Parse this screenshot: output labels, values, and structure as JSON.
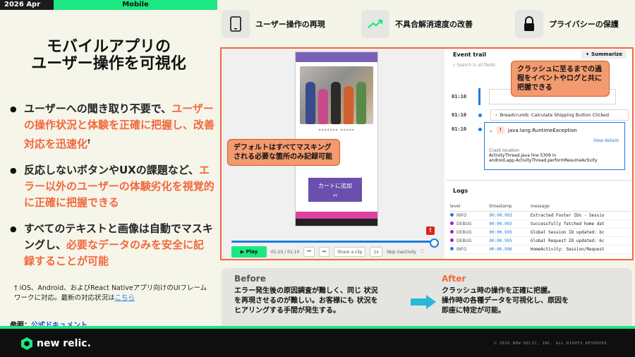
{
  "header": {
    "date": "2026 Apr",
    "category": "Mobile"
  },
  "title": {
    "line1": "モバイルアプリの",
    "line2": "ユーザー操作を可視化"
  },
  "bullets": [
    {
      "a": "ユーザーへの聞き取り不要で、",
      "b": "ユーザーの操作状況と体験を正確に把握し、改善対応を迅速化",
      "c": "",
      "sup": "†"
    },
    {
      "a": "反応しないボタンやUXの課題など、",
      "b": "エラー以外のユーザーの体験劣化を視覚的に正確に把握できる",
      "c": "",
      "sup": ""
    },
    {
      "a": "すべてのテキストと画像は自動でマスキングし、",
      "b": "必要なデータのみを安全に記録することが可能",
      "c": "",
      "sup": ""
    }
  ],
  "footnote": {
    "text": "† iOS、Android、およびReact Nativeアプリ向けのUIフレームワークに対応。最新の対応状況は",
    "link": "こちら"
  },
  "reference": {
    "label": "参照：",
    "link": "公式ドキュメント"
  },
  "features": [
    {
      "label": "ユーザー操作の再現",
      "icon": "phone-icon"
    },
    {
      "label": "不具合解消速度の改善",
      "icon": "trend-up-icon"
    },
    {
      "label": "プライバシーの保護",
      "icon": "lock-icon"
    }
  ],
  "player": {
    "product_name": "******* *****",
    "add_to_cart": "カートに追加",
    "add_to_cart_sub": "¥¥",
    "play": "Play",
    "time": "01:10 / 01:10",
    "share": "Share a clip",
    "speed": "1x",
    "skip": "Skip inactivity"
  },
  "event_trail": {
    "title": "Event trail",
    "summarize": "Summarize",
    "search_placeholder": "Search in all fields",
    "rows": [
      {
        "time": "01:10",
        "text": ""
      },
      {
        "time": "01:10",
        "text": "Breadcrumb: Calculate Shipping Button Clicked"
      },
      {
        "time": "01:10",
        "text": "java.lang.RuntimeException"
      }
    ],
    "view_details": "View details",
    "crash_location_label": "Crash location",
    "crash_location_1": "ActivityThread.java line 5309 in",
    "crash_location_2": "android.app.ActivityThread.performResumeActivity"
  },
  "logs": {
    "title": "Logs",
    "columns": [
      "level",
      "timestamp",
      "message"
    ],
    "rows": [
      {
        "level": "INFO",
        "color": "#1d7ce0",
        "ts": "00:00.993",
        "msg": "Extracted Footer IDs - Sessio"
      },
      {
        "level": "DEBUG",
        "color": "#a020c0",
        "ts": "00:00.993",
        "msg": "Successfully fetched home dat"
      },
      {
        "level": "DEBUG",
        "color": "#a020c0",
        "ts": "00:00.995",
        "msg": "Global Session ID updated: bc"
      },
      {
        "level": "DEBUG",
        "color": "#a020c0",
        "ts": "00:00.995",
        "msg": "Global Request ID updated: 6c"
      },
      {
        "level": "INFO",
        "color": "#1d7ce0",
        "ts": "00:00.996",
        "msg": "HomeActivity: Session/Request"
      }
    ]
  },
  "callouts": {
    "events": "クラッシュに至るまでの過程をイベントやログと共に把握できる",
    "masking": "デフォルトはすべてマスキングされる必要な箇所のみ記録可能"
  },
  "before_after": {
    "before_label": "Before",
    "before_text_1": "エラー発生後の原因調査が難しく、同じ 状況",
    "before_text_2": "を再現させるのが難しい。お客様にも 状況を",
    "before_text_3": "ヒアリングする手間が発生する。",
    "after_label": "After",
    "after_text_1": "クラッシュ時の操作を正確に把握。",
    "after_text_2": "操作時の各種データを可視化し、原因を",
    "after_text_3": "即座に特定が可能。"
  },
  "footer": {
    "brand": "new relic.",
    "copyright": "© 2026 NEW RELIC, INC. ALL RIGHTS RESERVED."
  },
  "colors": {
    "accent": "#f2683c",
    "brand": "#1ce783",
    "link": "#1d7ce0"
  }
}
